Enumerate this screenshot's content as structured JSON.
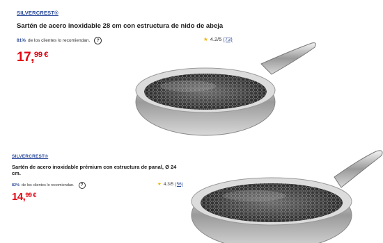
{
  "products": [
    {
      "brand": "SILVERCREST®",
      "title": "Sartén de acero inoxidable 28 cm con estructura de nido de abeja",
      "recommend_pct": "81%",
      "recommend_text": "de los clientes lo recomiendan.",
      "help_icon": "?",
      "rating": "4.2/5",
      "review_count": "(73)",
      "price_main": "17,",
      "price_cents": "99 €"
    },
    {
      "brand": "SILVERCREST®",
      "title": "Sartén de acero inoxidable prémium con estructura de panal, Ø 24 cm.",
      "recommend_pct": "82%",
      "recommend_text": "de los clientes lo recomiendan.",
      "help_icon": "?",
      "rating": "4.3/5",
      "review_count": "(56)",
      "price_main": "14,",
      "price_cents": "99 €"
    }
  ],
  "icons": {
    "star": "star-icon",
    "help": "help-circle-icon"
  },
  "colors": {
    "brand_link": "#2b4a9b",
    "price": "#e30613",
    "star": "#f0b400"
  }
}
